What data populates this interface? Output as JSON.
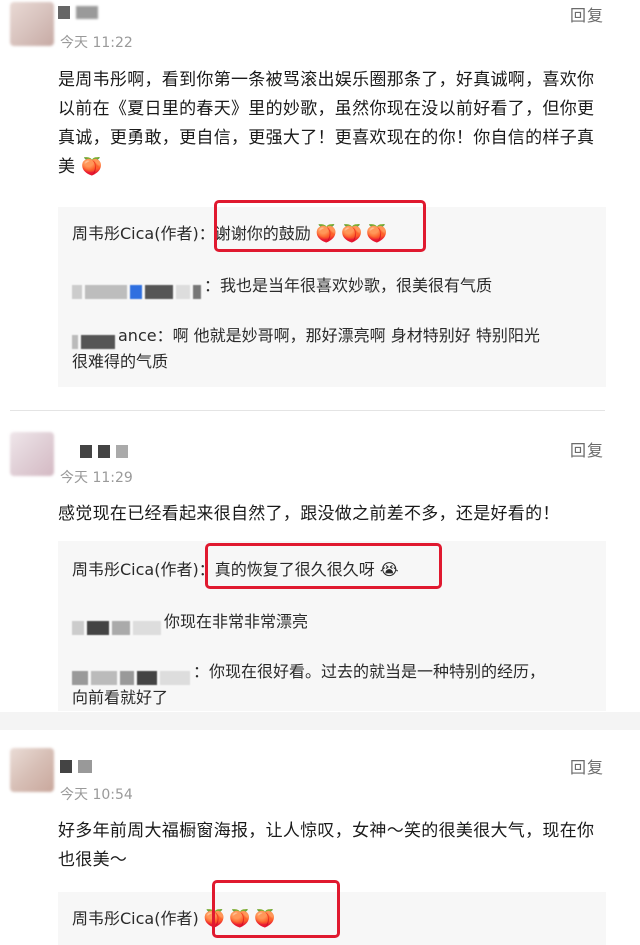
{
  "comments": [
    {
      "time": "今天 11:22",
      "reply_label": "回复",
      "text_lines": [
        "是周韦彤啊，看到你第一条被骂滚出娱乐圈那条了，好真诚啊，喜欢你",
        "以前在《夏日里的春天》里的妙歌，虽然你现在没以前好看了，但你更",
        "真诚，更勇敢，更自信，更强大了！更喜欢现在的你！你自信的样子真",
        "美"
      ],
      "text_emoji": "🍑",
      "replies": [
        {
          "author": "周韦彤Cica(作者)",
          "text": "：谢谢你的鼓励",
          "emoji": "🍑🍑🍑"
        },
        {
          "author_suffix": "：",
          "text": "我也是当年很喜欢妙歌，很美很有气质"
        },
        {
          "author_suffix": "ance：",
          "text_line1": "啊 他就是妙哥啊，那好漂亮啊 身材特别好 特别阳光",
          "text_line2": "很难得的气质"
        }
      ]
    },
    {
      "time": "今天 11:29",
      "reply_label": "回复",
      "text": "感觉现在已经看起来很自然了，跟没做之前差不多，还是好看的！",
      "replies": [
        {
          "author": "周韦彤Cica(作者)",
          "text": "：真的恢复了很久很久呀",
          "emoji": "😭"
        },
        {
          "text": "你现在非常非常漂亮"
        },
        {
          "author_suffix": "：",
          "text_line1": "你现在很好看。过去的就当是一种特别的经历，",
          "text_line2": "向前看就好了"
        }
      ]
    },
    {
      "time": "今天 10:54",
      "reply_label": "回复",
      "text_lines": [
        "好多年前周大福橱窗海报，让人惊叹，女神～笑的很美很大气，现在你",
        "也很美～"
      ],
      "replies": [
        {
          "author": "周韦彤Cica(作者)",
          "emoji": "🍑🍑🍑"
        }
      ]
    }
  ],
  "colors": {
    "highlight": "#e0192f",
    "subbox_bg": "#f7f7f7",
    "time": "#9a9a9a"
  }
}
